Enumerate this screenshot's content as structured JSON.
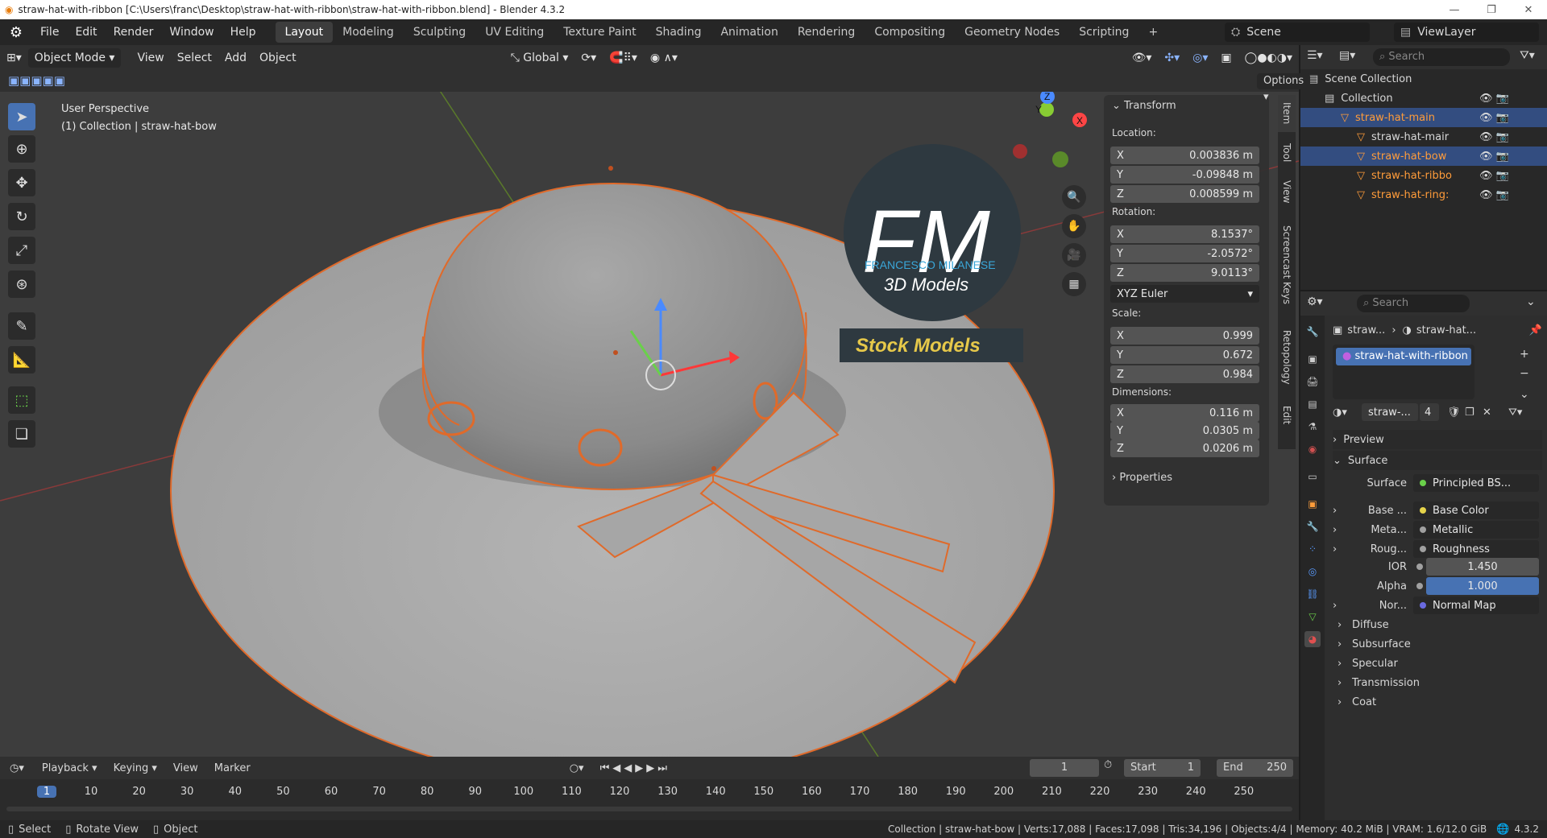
{
  "window": {
    "title": "straw-hat-with-ribbon [C:\\Users\\franc\\Desktop\\straw-hat-with-ribbon\\straw-hat-with-ribbon.blend] - Blender 4.3.2"
  },
  "menu": [
    "File",
    "Edit",
    "Render",
    "Window",
    "Help"
  ],
  "workspaces": [
    "Layout",
    "Modeling",
    "Sculpting",
    "UV Editing",
    "Texture Paint",
    "Shading",
    "Animation",
    "Rendering",
    "Compositing",
    "Geometry Nodes",
    "Scripting"
  ],
  "scene": {
    "name": "Scene",
    "view_layer": "ViewLayer"
  },
  "header": {
    "mode": "Object Mode",
    "view": "View",
    "select": "Select",
    "add": "Add",
    "object": "Object",
    "orientation": "Global",
    "options": "Options"
  },
  "viewport": {
    "perspective": "User Perspective",
    "collection_info": "(1) Collection | straw-hat-bow"
  },
  "gizmo": {
    "x": "X",
    "y": "Y",
    "z": "Z"
  },
  "watermark": {
    "letters": "FM",
    "name": "FRANCESCO MILANESE",
    "sub": "3D Models",
    "banner": "Stock Models"
  },
  "transform": {
    "title": "Transform",
    "location_label": "Location:",
    "location": [
      "0.003836 m",
      "-0.09848 m",
      "0.008599 m"
    ],
    "rotation_label": "Rotation:",
    "rotation": [
      "8.1537°",
      "-2.0572°",
      "9.0113°"
    ],
    "rotation_mode": "XYZ Euler",
    "scale_label": "Scale:",
    "scale": [
      "0.999",
      "0.672",
      "0.984"
    ],
    "dimensions_label": "Dimensions:",
    "dimensions": [
      "0.116 m",
      "0.0305 m",
      "0.0206 m"
    ],
    "properties": "Properties",
    "axes": [
      "X",
      "Y",
      "Z"
    ]
  },
  "ntabs": [
    "Item",
    "Tool",
    "View",
    "Screencast Keys",
    "Retopology",
    "Edit"
  ],
  "timeline": {
    "playback": "Playback",
    "keying": "Keying",
    "view": "View",
    "marker": "Marker",
    "frame": "1",
    "start_label": "Start",
    "start": "1",
    "end_label": "End",
    "end": "250",
    "ticks": [
      "1",
      "10",
      "20",
      "30",
      "40",
      "50",
      "60",
      "70",
      "80",
      "90",
      "100",
      "110",
      "120",
      "130",
      "140",
      "150",
      "160",
      "170",
      "180",
      "190",
      "200",
      "210",
      "220",
      "230",
      "240",
      "250"
    ]
  },
  "status": {
    "select": "Select",
    "rotate": "Rotate View",
    "object": "Object",
    "info": "Collection | straw-hat-bow | Verts:17,088 | Faces:17,098 | Tris:34,196 | Objects:4/4 | Memory: 40.2 MiB | VRAM: 1.6/12.0 GiB",
    "version": "4.3.2"
  },
  "outliner": {
    "search": "Search",
    "rows": [
      {
        "label": "Scene Collection",
        "indent": 0,
        "color": "#d8d8d8",
        "sel": false
      },
      {
        "label": "Collection",
        "indent": 1,
        "color": "#d8d8d8",
        "sel": false
      },
      {
        "label": "straw-hat-main",
        "indent": 2,
        "color": "#ff9c3a",
        "sel": true
      },
      {
        "label": "straw-hat-mair",
        "indent": 3,
        "color": "#d8d8d8",
        "sel": false
      },
      {
        "label": "straw-hat-bow",
        "indent": 3,
        "color": "#ff9c3a",
        "sel": true
      },
      {
        "label": "straw-hat-ribbo",
        "indent": 3,
        "color": "#ff9c3a",
        "sel": false
      },
      {
        "label": "straw-hat-ring:",
        "indent": 3,
        "color": "#ff9c3a",
        "sel": false
      }
    ]
  },
  "properties": {
    "search": "Search",
    "crumb1": "straw...",
    "crumb2": "straw-hat...",
    "material": "straw-hat-with-ribbon",
    "mat_short": "straw-...",
    "users": "4",
    "preview": "Preview",
    "surface_section": "Surface",
    "surface_label": "Surface",
    "surface_value": "Principled BS...",
    "rows": [
      {
        "label": "Base ...",
        "value": "Base Color",
        "sock": "#e5d34a"
      },
      {
        "label": "Meta...",
        "value": "Metallic",
        "sock": "#a0a0a0"
      },
      {
        "label": "Roug...",
        "value": "Roughness",
        "sock": "#a0a0a0"
      }
    ],
    "ior_label": "IOR",
    "ior": "1.450",
    "alpha_label": "Alpha",
    "alpha": "1.000",
    "normal_label": "Nor...",
    "normal_value": "Normal Map",
    "subsections": [
      "Diffuse",
      "Subsurface",
      "Specular",
      "Transmission",
      "Coat"
    ]
  }
}
